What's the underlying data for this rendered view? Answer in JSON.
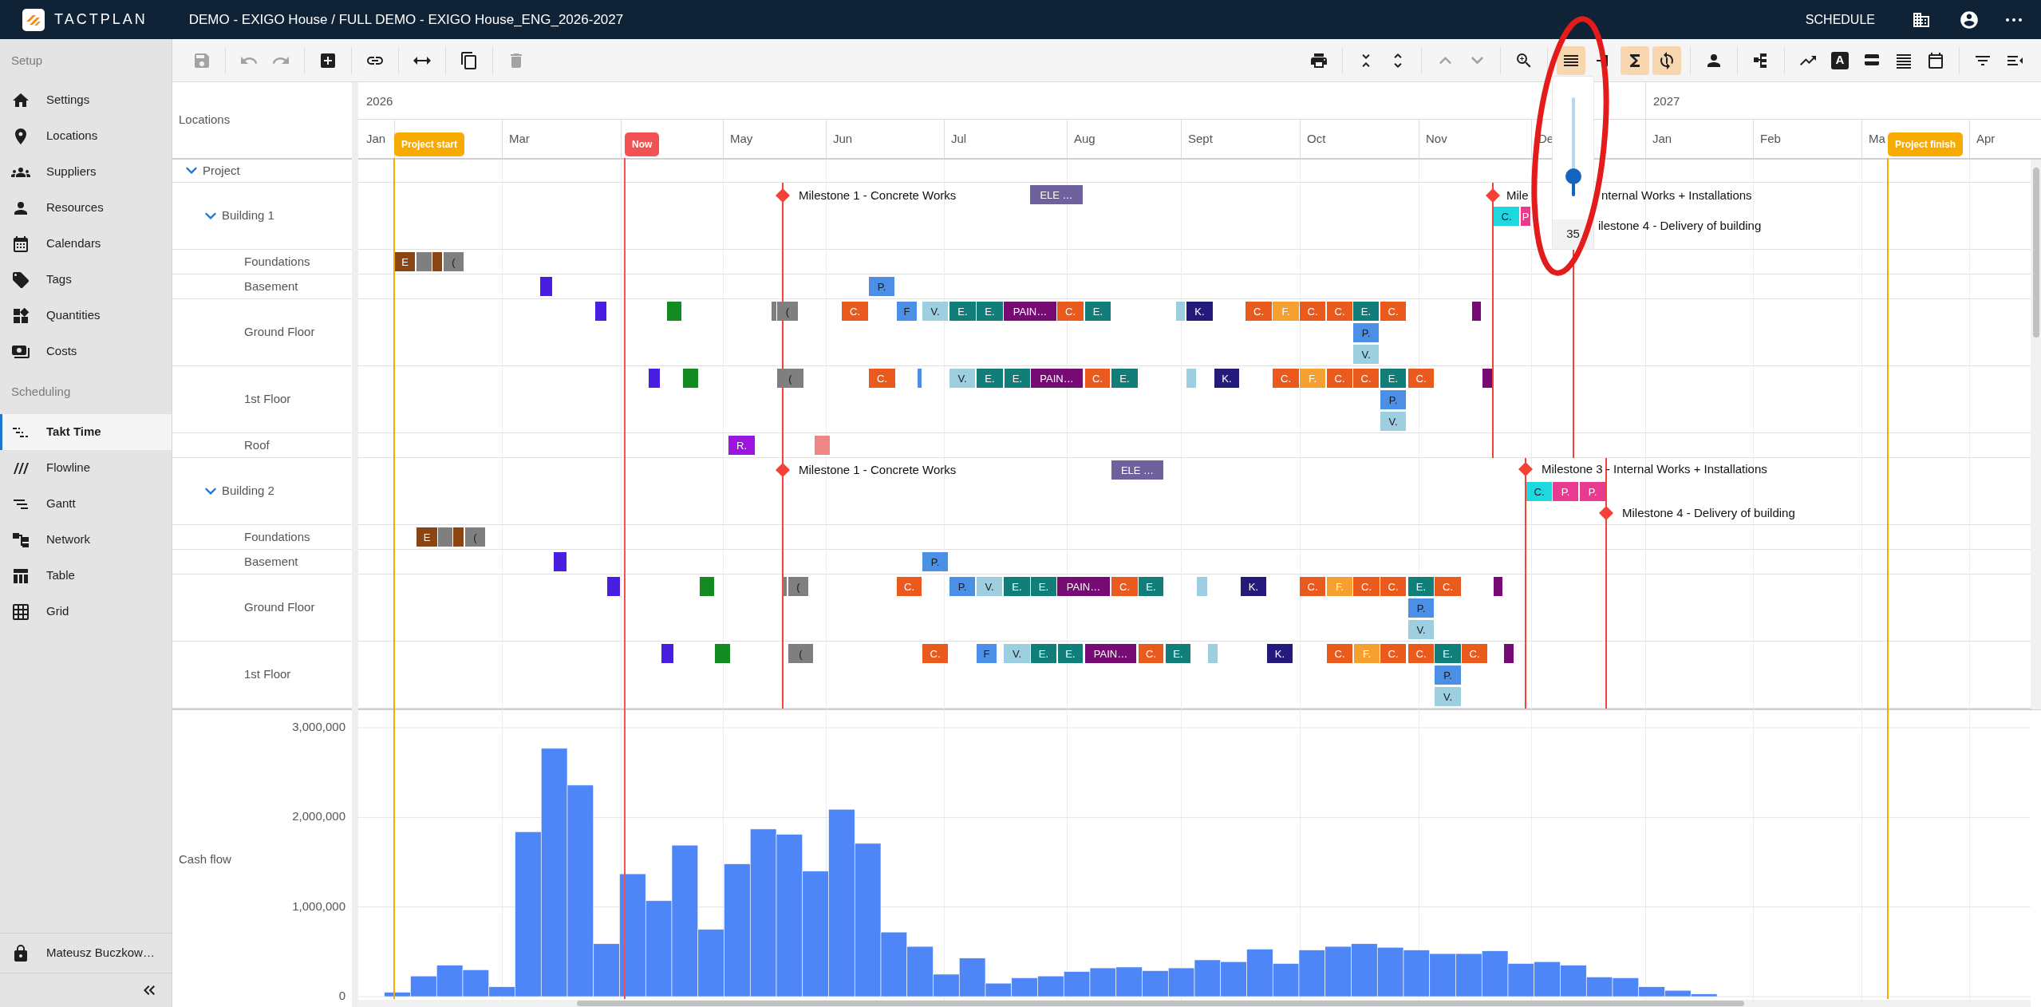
{
  "app": {
    "logo_text": "TACTPLAN",
    "title": "DEMO - EXIGO House / FULL DEMO - EXIGO House_ENG_2026-2027",
    "mode": "SCHEDULE"
  },
  "sidebar": {
    "sections": [
      {
        "title": "Setup",
        "items": [
          {
            "label": "Settings",
            "selected": false
          },
          {
            "label": "Locations",
            "selected": false
          },
          {
            "label": "Suppliers",
            "selected": false
          },
          {
            "label": "Resources",
            "selected": false
          },
          {
            "label": "Calendars",
            "selected": false
          },
          {
            "label": "Tags",
            "selected": false
          },
          {
            "label": "Quantities",
            "selected": false
          },
          {
            "label": "Costs",
            "selected": false
          }
        ]
      },
      {
        "title": "Scheduling",
        "items": [
          {
            "label": "Takt Time",
            "selected": true
          },
          {
            "label": "Flowline",
            "selected": false
          },
          {
            "label": "Gantt",
            "selected": false
          },
          {
            "label": "Network",
            "selected": false
          },
          {
            "label": "Table",
            "selected": false
          },
          {
            "label": "Grid",
            "selected": false
          }
        ]
      }
    ],
    "user": "Mateusz Buczkow…"
  },
  "toolbar": {
    "left": [
      {
        "disabled": true,
        "on": false
      },
      {
        "disabled": true,
        "on": false
      },
      {
        "disabled": true,
        "on": false
      },
      {
        "disabled": false,
        "on": false
      },
      {
        "disabled": false,
        "on": false
      },
      {
        "disabled": false,
        "on": false
      },
      {
        "disabled": false,
        "on": false
      },
      {
        "disabled": true,
        "on": false
      }
    ],
    "right": [
      {
        "disabled": false,
        "on": false
      },
      {
        "disabled": false,
        "on": false
      },
      {
        "disabled": false,
        "on": false
      },
      {
        "disabled": true,
        "on": false
      },
      {
        "disabled": true,
        "on": false
      },
      {
        "disabled": false,
        "on": false
      },
      {
        "disabled": false,
        "on": true
      },
      {
        "disabled": false,
        "on": false
      },
      {
        "disabled": false,
        "on": true
      },
      {
        "disabled": false,
        "on": true
      },
      {
        "disabled": false,
        "on": false
      },
      {
        "disabled": false,
        "on": false
      },
      {
        "disabled": false,
        "on": false
      },
      {
        "disabled": false,
        "on": false,
        "glyph": "A"
      },
      {
        "disabled": false,
        "on": false
      },
      {
        "disabled": false,
        "on": false
      },
      {
        "disabled": false,
        "on": false
      },
      {
        "disabled": false,
        "on": false
      },
      {
        "disabled": false,
        "on": false
      }
    ]
  },
  "timeline": {
    "locations_heading": "Locations",
    "years": [
      "2026",
      "2027"
    ],
    "months": [
      "Jan",
      "Mar",
      "May",
      "Jun",
      "Jul",
      "Aug",
      "Sept",
      "Oct",
      "Nov",
      "De",
      "Jan",
      "Feb",
      "Ma",
      "Apr"
    ],
    "markers": [
      {
        "label": "Project start",
        "kind": "start"
      },
      {
        "label": "Now",
        "kind": "now"
      },
      {
        "label": "Project finish",
        "kind": "finish"
      }
    ]
  },
  "locations": [
    {
      "name": "Project",
      "expanded": true,
      "children": [
        {
          "name": "Building 1",
          "expanded": true,
          "milestones": [
            {
              "label": "Milestone 1 - Concrete Works"
            },
            {
              "label": "Mile",
              "label_continued": "nternal Works + Installations"
            },
            {
              "label": "ilestone 4 - Delivery of building"
            }
          ],
          "tasks": [
            {
              "label": "ELE …",
              "color": "#6f609e"
            },
            {
              "label": "C.",
              "color": "#1ed8e0"
            },
            {
              "label": "P",
              "color": "#e83a8e"
            }
          ],
          "children": [
            {
              "name": "Foundations",
              "tasks": [
                {
                  "label": "E",
                  "color": "#8a4513"
                },
                {
                  "color": "#7f7f7f"
                },
                {
                  "color": "#8a4513"
                },
                {
                  "label": "(",
                  "color": "#7f7f7f"
                }
              ]
            },
            {
              "name": "Basement",
              "tasks": [
                {
                  "color": "#4a1ee0"
                },
                {
                  "label": "P.",
                  "color": "#4b8fe6"
                }
              ]
            },
            {
              "name": "Ground Floor",
              "tasks": [
                {
                  "color": "#4a1ee0"
                },
                {
                  "color": "#138a22"
                },
                {
                  "color": "#7f7f7f"
                },
                {
                  "label": "(",
                  "color": "#7f7f7f"
                },
                {
                  "label": "C.",
                  "color": "#e95a1c"
                },
                {
                  "label": "F",
                  "color": "#4b8fe6"
                },
                {
                  "label": "V.",
                  "color": "#9ecfe0"
                },
                {
                  "label": "E.",
                  "color": "#127e7a"
                },
                {
                  "label": "E.",
                  "color": "#127e7a"
                },
                {
                  "label": "PAIN…",
                  "color": "#760b74"
                },
                {
                  "label": "C.",
                  "color": "#e95a1c"
                },
                {
                  "label": "E.",
                  "color": "#127e7a"
                },
                {
                  "color": "#9ecfe0"
                },
                {
                  "label": "K.",
                  "color": "#241a7c"
                },
                {
                  "label": "C.",
                  "color": "#e95a1c"
                },
                {
                  "label": "F.",
                  "color": "#f5a030"
                },
                {
                  "label": "C.",
                  "color": "#e95a1c"
                },
                {
                  "label": "C.",
                  "color": "#e95a1c"
                },
                {
                  "label": "E.",
                  "color": "#127e7a"
                },
                {
                  "label": "C.",
                  "color": "#e95a1c"
                },
                {
                  "label": "P.",
                  "color": "#4b8fe6"
                },
                {
                  "label": "V.",
                  "color": "#9ecfe0"
                },
                {
                  "color": "#760b74"
                }
              ]
            },
            {
              "name": "1st Floor",
              "tasks": [
                {
                  "color": "#4a1ee0"
                },
                {
                  "color": "#138a22"
                },
                {
                  "label": "(",
                  "color": "#7f7f7f"
                },
                {
                  "label": "C.",
                  "color": "#e95a1c"
                },
                {
                  "color": "#4b8fe6"
                },
                {
                  "label": "V.",
                  "color": "#9ecfe0"
                },
                {
                  "label": "E.",
                  "color": "#127e7a"
                },
                {
                  "label": "E.",
                  "color": "#127e7a"
                },
                {
                  "label": "PAIN…",
                  "color": "#760b74"
                },
                {
                  "label": "C.",
                  "color": "#e95a1c"
                },
                {
                  "label": "E.",
                  "color": "#127e7a"
                },
                {
                  "color": "#9ecfe0"
                },
                {
                  "label": "K.",
                  "color": "#241a7c"
                },
                {
                  "label": "C.",
                  "color": "#e95a1c"
                },
                {
                  "label": "F.",
                  "color": "#f5a030"
                },
                {
                  "label": "C.",
                  "color": "#e95a1c"
                },
                {
                  "label": "C.",
                  "color": "#e95a1c"
                },
                {
                  "label": "E.",
                  "color": "#127e7a"
                },
                {
                  "label": "C.",
                  "color": "#e95a1c"
                },
                {
                  "label": "P.",
                  "color": "#4b8fe6"
                },
                {
                  "label": "V.",
                  "color": "#9ecfe0"
                },
                {
                  "color": "#760b74"
                }
              ]
            },
            {
              "name": "Roof",
              "tasks": [
                {
                  "label": "R.",
                  "color": "#9b14e0"
                },
                {
                  "color": "#f08585"
                }
              ]
            }
          ]
        },
        {
          "name": "Building 2",
          "expanded": true,
          "milestones": [
            {
              "label": "Milestone 1 - Concrete Works"
            },
            {
              "label": "Milestone 3 - Internal Works + Installations"
            },
            {
              "label": "Milestone 4 - Delivery of building"
            }
          ],
          "tasks": [
            {
              "label": "ELE …",
              "color": "#6f609e"
            },
            {
              "label": "C.",
              "color": "#1ed8e0"
            },
            {
              "label": "P.",
              "color": "#e83a8e"
            },
            {
              "label": "P.",
              "color": "#e83a8e"
            }
          ],
          "children": [
            {
              "name": "Foundations",
              "tasks": [
                {
                  "label": "E",
                  "color": "#8a4513"
                },
                {
                  "color": "#7f7f7f"
                },
                {
                  "color": "#8a4513"
                },
                {
                  "label": "(",
                  "color": "#7f7f7f"
                }
              ]
            },
            {
              "name": "Basement",
              "tasks": [
                {
                  "color": "#4a1ee0"
                },
                {
                  "label": "P.",
                  "color": "#4b8fe6"
                }
              ]
            },
            {
              "name": "Ground Floor",
              "tasks": [
                {
                  "color": "#4a1ee0"
                },
                {
                  "color": "#138a22"
                },
                {
                  "color": "#7f7f7f"
                },
                {
                  "label": "(",
                  "color": "#7f7f7f"
                },
                {
                  "label": "C.",
                  "color": "#e95a1c"
                },
                {
                  "label": "P.",
                  "color": "#4b8fe6"
                },
                {
                  "label": "V.",
                  "color": "#9ecfe0"
                },
                {
                  "label": "E.",
                  "color": "#127e7a"
                },
                {
                  "label": "E.",
                  "color": "#127e7a"
                },
                {
                  "label": "PAIN…",
                  "color": "#760b74"
                },
                {
                  "label": "C.",
                  "color": "#e95a1c"
                },
                {
                  "label": "E.",
                  "color": "#127e7a"
                },
                {
                  "color": "#9ecfe0"
                },
                {
                  "label": "K.",
                  "color": "#241a7c"
                },
                {
                  "label": "C.",
                  "color": "#e95a1c"
                },
                {
                  "label": "F.",
                  "color": "#f5a030"
                },
                {
                  "label": "C.",
                  "color": "#e95a1c"
                },
                {
                  "label": "C.",
                  "color": "#e95a1c"
                },
                {
                  "label": "E.",
                  "color": "#127e7a"
                },
                {
                  "label": "C.",
                  "color": "#e95a1c"
                },
                {
                  "label": "P.",
                  "color": "#4b8fe6"
                },
                {
                  "label": "V.",
                  "color": "#9ecfe0"
                },
                {
                  "color": "#760b74"
                }
              ]
            },
            {
              "name": "1st Floor",
              "tasks": [
                {
                  "color": "#4a1ee0"
                },
                {
                  "color": "#138a22"
                },
                {
                  "label": "(",
                  "color": "#7f7f7f"
                },
                {
                  "label": "C.",
                  "color": "#e95a1c"
                },
                {
                  "label": "F",
                  "color": "#4b8fe6"
                },
                {
                  "label": "V.",
                  "color": "#9ecfe0"
                },
                {
                  "label": "E.",
                  "color": "#127e7a"
                },
                {
                  "label": "E.",
                  "color": "#127e7a"
                },
                {
                  "label": "PAIN…",
                  "color": "#760b74"
                },
                {
                  "label": "C.",
                  "color": "#e95a1c"
                },
                {
                  "label": "E.",
                  "color": "#127e7a"
                },
                {
                  "color": "#9ecfe0"
                },
                {
                  "label": "K.",
                  "color": "#241a7c"
                },
                {
                  "label": "C.",
                  "color": "#e95a1c"
                },
                {
                  "label": "F.",
                  "color": "#f5a030"
                },
                {
                  "label": "C.",
                  "color": "#e95a1c"
                },
                {
                  "label": "C.",
                  "color": "#e95a1c"
                },
                {
                  "label": "E.",
                  "color": "#127e7a"
                },
                {
                  "label": "C.",
                  "color": "#e95a1c"
                },
                {
                  "label": "P.",
                  "color": "#4b8fe6"
                },
                {
                  "label": "V.",
                  "color": "#9ecfe0"
                },
                {
                  "color": "#760b74"
                }
              ]
            }
          ]
        }
      ]
    }
  ],
  "zoom_popup": {
    "level": 0.2,
    "value": "35"
  },
  "cash_flow": {
    "label": "Cash flow",
    "chart_data": {
      "type": "bar",
      "grid": true,
      "ylim": [
        0,
        3000000
      ],
      "categories": [
        null,
        null,
        null,
        null,
        null,
        null,
        null,
        null,
        null,
        null,
        null,
        null,
        null,
        null,
        null,
        null,
        null,
        null,
        null,
        null,
        null,
        null,
        null,
        null,
        null,
        null,
        null,
        null,
        null,
        null,
        null,
        null,
        null,
        null,
        null,
        null,
        null,
        null,
        null,
        null,
        null,
        null,
        null,
        null,
        null,
        null,
        null,
        null,
        null,
        null,
        null,
        null,
        null,
        null,
        null,
        null,
        null,
        null,
        null,
        null,
        null,
        null,
        null,
        null
      ],
      "yticks": [
        {
          "value": 0,
          "label": "0"
        },
        {
          "value": 1000000,
          "label": "1,000,000"
        },
        {
          "value": 2000000,
          "label": "2,000,000"
        },
        {
          "value": 3000000,
          "label": "3,000,000"
        }
      ],
      "values": [
        null,
        50000,
        230000,
        350000,
        300000,
        110000,
        1840000,
        2770000,
        2360000,
        590000,
        1370000,
        1070000,
        1690000,
        750000,
        1480000,
        1870000,
        1810000,
        1400000,
        2090000,
        1710000,
        720000,
        560000,
        250000,
        430000,
        150000,
        210000,
        230000,
        280000,
        320000,
        330000,
        290000,
        320000,
        410000,
        390000,
        530000,
        370000,
        520000,
        560000,
        590000,
        550000,
        520000,
        480000,
        480000,
        510000,
        370000,
        390000,
        350000,
        220000,
        210000,
        110000,
        70000,
        30000,
        null,
        null,
        null,
        null,
        null,
        null,
        null,
        null,
        null,
        null,
        null,
        null
      ]
    }
  }
}
